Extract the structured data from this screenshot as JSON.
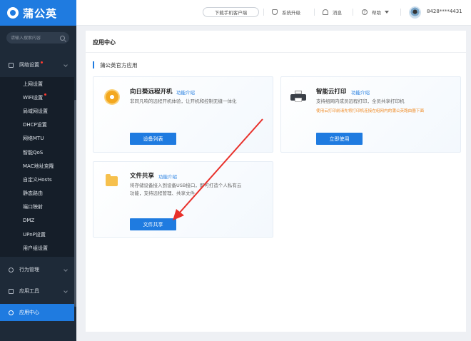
{
  "app": {
    "logo_text": "蒲公英"
  },
  "sidebar": {
    "search_placeholder": "请输入搜索内容",
    "groups": [
      {
        "label": "网络设置",
        "icon": "network-settings-icon"
      },
      {
        "label": "行为管理",
        "icon": "behavior-icon"
      },
      {
        "label": "应用工具",
        "icon": "tools-icon"
      },
      {
        "label": "应用中心",
        "icon": "app-center-icon"
      }
    ],
    "network_items": [
      "上网设置",
      "WiFi设置",
      "局域网设置",
      "DHCP设置",
      "网络MTU",
      "智能QoS",
      "MAC地址克隆",
      "自定义Hosts",
      "静态路由",
      "端口映射",
      "DMZ",
      "UPnP设置",
      "用户组设置"
    ]
  },
  "header": {
    "download_label": "下载手机客户端",
    "upgrade_label": "系统升级",
    "message_label": "消息",
    "help_label": "帮助",
    "account": "8428****4431"
  },
  "main": {
    "page_title": "应用中心",
    "section_title": "蒲公英官方应用",
    "feature_link": "功能介绍",
    "cards": {
      "remote_boot": {
        "title": "向日葵远程开机",
        "desc": "非同凡响的远程开机体验，让开机和控制无缝一体化",
        "button": "设备列表"
      },
      "cloud_print": {
        "title": "智能云打印",
        "desc": "支持组网内成员远程打印，全员共享打印机",
        "warning": "使用云打印前请先将打印机连接在组网内的蒲公英路由器下面",
        "button": "立即使用"
      },
      "file_share": {
        "title": "文件共享",
        "desc_line1": "将存储设备接入到设备USB接口，即可打造个人私有云",
        "desc_line2": "功能，支持远程管理、共享文件",
        "button": "文件共享"
      }
    }
  },
  "colors": {
    "brand": "#1f7be0",
    "sidebar_bg": "#1e2a38",
    "annotation_arrow": "#e8302a",
    "warning": "#f08a24"
  }
}
